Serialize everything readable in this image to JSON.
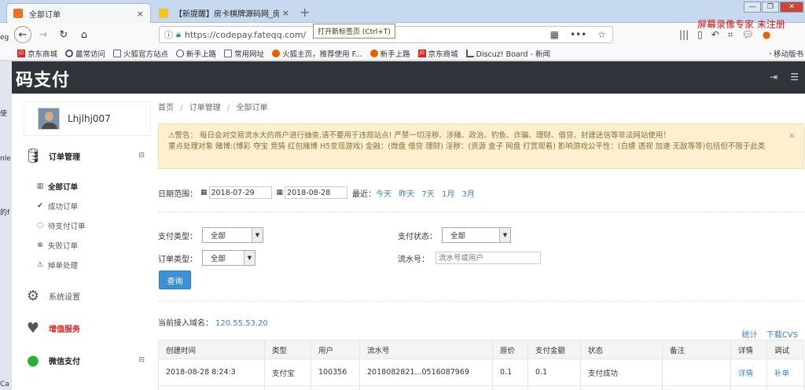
{
  "browser": {
    "tabs": [
      {
        "label": "全部订单",
        "close": "×"
      },
      {
        "label": "【新提醒】房卡棋牌源码网_房",
        "close": "×"
      }
    ],
    "new_tab_tooltip": "打开新标签页 (Ctrl+T)",
    "recorder_watermark": "屏幕录像专家 未注册",
    "url": "https://codepay.fateqq.com/",
    "window_controls": [
      "—",
      "❐",
      "✕"
    ]
  },
  "bookmarks": [
    {
      "label": "京东商城",
      "icon": "jd-icon"
    },
    {
      "label": "最常访问",
      "icon": "gear-icon"
    },
    {
      "label": "火狐官方站点",
      "icon": "folder-icon"
    },
    {
      "label": "新手上路",
      "icon": "globe-icon"
    },
    {
      "label": "常用网址",
      "icon": "folder-icon"
    },
    {
      "label": "火狐主页，推荐使用 F...",
      "icon": "firefox-icon"
    },
    {
      "label": "新手上路",
      "icon": "firefox-icon"
    },
    {
      "label": "京东商城",
      "icon": "jd-icon"
    },
    {
      "label": "Discuz! Board - 新闻",
      "icon": "rss-icon"
    }
  ],
  "bookmarks_mobile": "移动版书",
  "app": {
    "logo": "码支付",
    "username": "Lhjlhj007"
  },
  "sidebar": {
    "section_orders": "订单管理",
    "section_toggle": "⊟",
    "orders_items": [
      {
        "label": "全部订单",
        "icon": "chart-icon"
      },
      {
        "label": "成功订单",
        "icon": "check-circle-icon"
      },
      {
        "label": "待支付订单",
        "icon": "spinner-icon"
      },
      {
        "label": "失败订单",
        "icon": "x-circle-icon"
      },
      {
        "label": "掉单处理",
        "icon": "warning-icon"
      }
    ],
    "settings": "系统设置",
    "value_added": "增值服务",
    "wechat_pay": "微信支付"
  },
  "left_remnants": [
    "使",
    "eg",
    "nle",
    "的f",
    "Ca"
  ],
  "main": {
    "breadcrumb": [
      "首页",
      "订单管理",
      "全部订单"
    ],
    "breadcrumb_sep": "/",
    "alert_line1": "⚠警告： 每日会对交易流水大的商户进行抽查,请不要用于违规站点! 严禁一切淫秽、涉赌、政治、钓鱼、诈骗、理财、借贷、封建迷信等非法网站使用！",
    "alert_line2": "重点处理对象 赌博:(博彩 夺宝 竞猜 红包赌博 H5变现游戏) 金融：(微盘 借贷 理财) 淫秽：(资源 盒子 网盘 打赏观看) 影响游戏公平性：(白嫖 透视 加速 无敌等等)包括但不限于此类",
    "alert_close": "×",
    "date_label": "日期范围：",
    "date_from": "2018-07-29",
    "date_to": "2018-08-28",
    "recent_label": "最近：",
    "quick": [
      "今天",
      "昨天",
      "7天",
      "1月",
      "3月"
    ],
    "pay_type_label": "支付类型：",
    "pay_type_value": "全部",
    "pay_status_label": "支付状态：",
    "pay_status_value": "全部",
    "order_type_label": "订单类型：",
    "order_type_value": "全部",
    "serial_label": "流水号：",
    "serial_placeholder": "流水号或用户",
    "query_button": "查询",
    "domain_label": "当前接入域名：",
    "domain_value": "120.55.53.20",
    "stats_link": "统计",
    "csv_link": "下载CVS"
  },
  "table": {
    "headers": [
      "创建时间",
      "类型",
      "用户",
      "流水号",
      "原价",
      "支付金额",
      "状态",
      "备注",
      "详情",
      "调试"
    ],
    "rows": [
      [
        "2018-08-28 8:24:3",
        "支付宝",
        "100356",
        "2018082821...0516087969",
        "0.1",
        "0.1",
        "支付成功",
        "",
        "详情",
        "补单"
      ]
    ]
  }
}
